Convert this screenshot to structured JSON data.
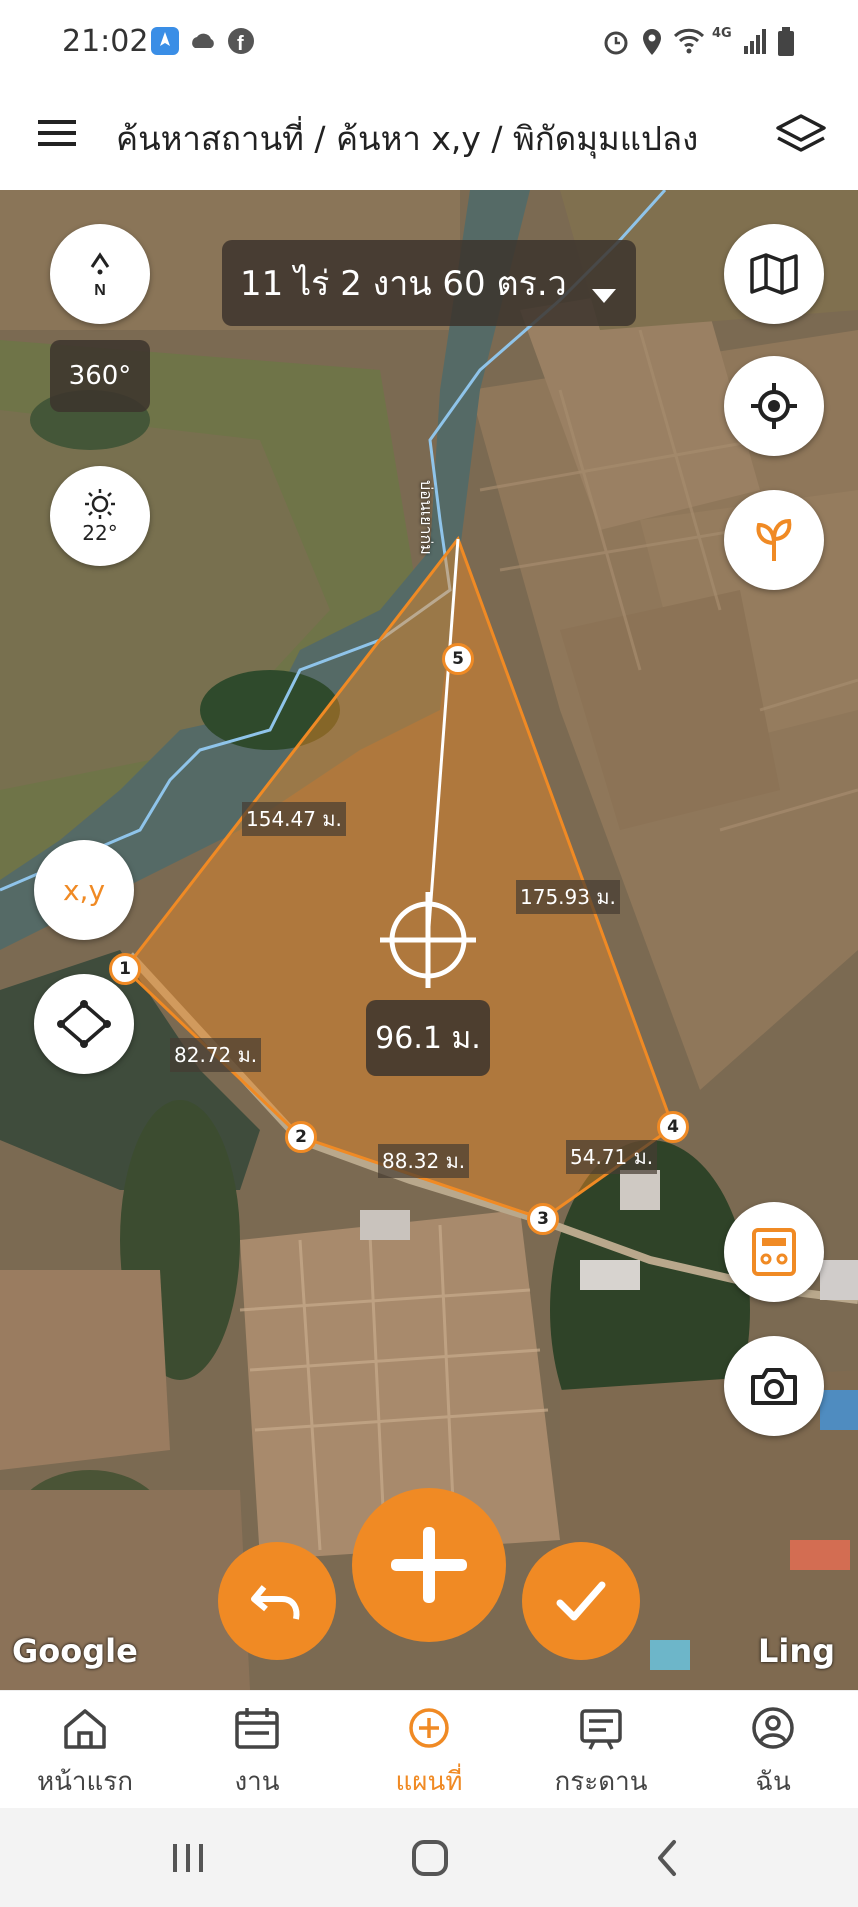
{
  "status": {
    "time": "21:02",
    "network": "4G"
  },
  "header": {
    "title": "ค้นหาสถานที่ / ค้นหา x,y / พิกัดมุมแปลง"
  },
  "map": {
    "area_label": "11 ไร่ 2 งาน 60 ตร.ว",
    "compass": "N",
    "rotation": "360°",
    "sun": "22°",
    "xy_label": "x,y",
    "center_distance": "96.1 ม.",
    "segments": [
      "154.47 ม.",
      "175.93 ม.",
      "82.72 ม.",
      "88.32 ม.",
      "54.71 ม."
    ],
    "vertices": [
      "1",
      "2",
      "3",
      "4",
      "5"
    ],
    "road_label": "บ่อนเยาก่ม",
    "google": "Google",
    "ling": "Ling"
  },
  "nav": [
    {
      "label": "หน้าแรก",
      "icon": "home-icon"
    },
    {
      "label": "งาน",
      "icon": "calendar-icon"
    },
    {
      "label": "แผนที่",
      "icon": "add-circle-icon"
    },
    {
      "label": "กระดาน",
      "icon": "board-icon"
    },
    {
      "label": "ฉัน",
      "icon": "profile-icon"
    }
  ],
  "colors": {
    "accent": "#f08a24",
    "polygon_fill": "rgba(240,138,36,0.45)"
  }
}
